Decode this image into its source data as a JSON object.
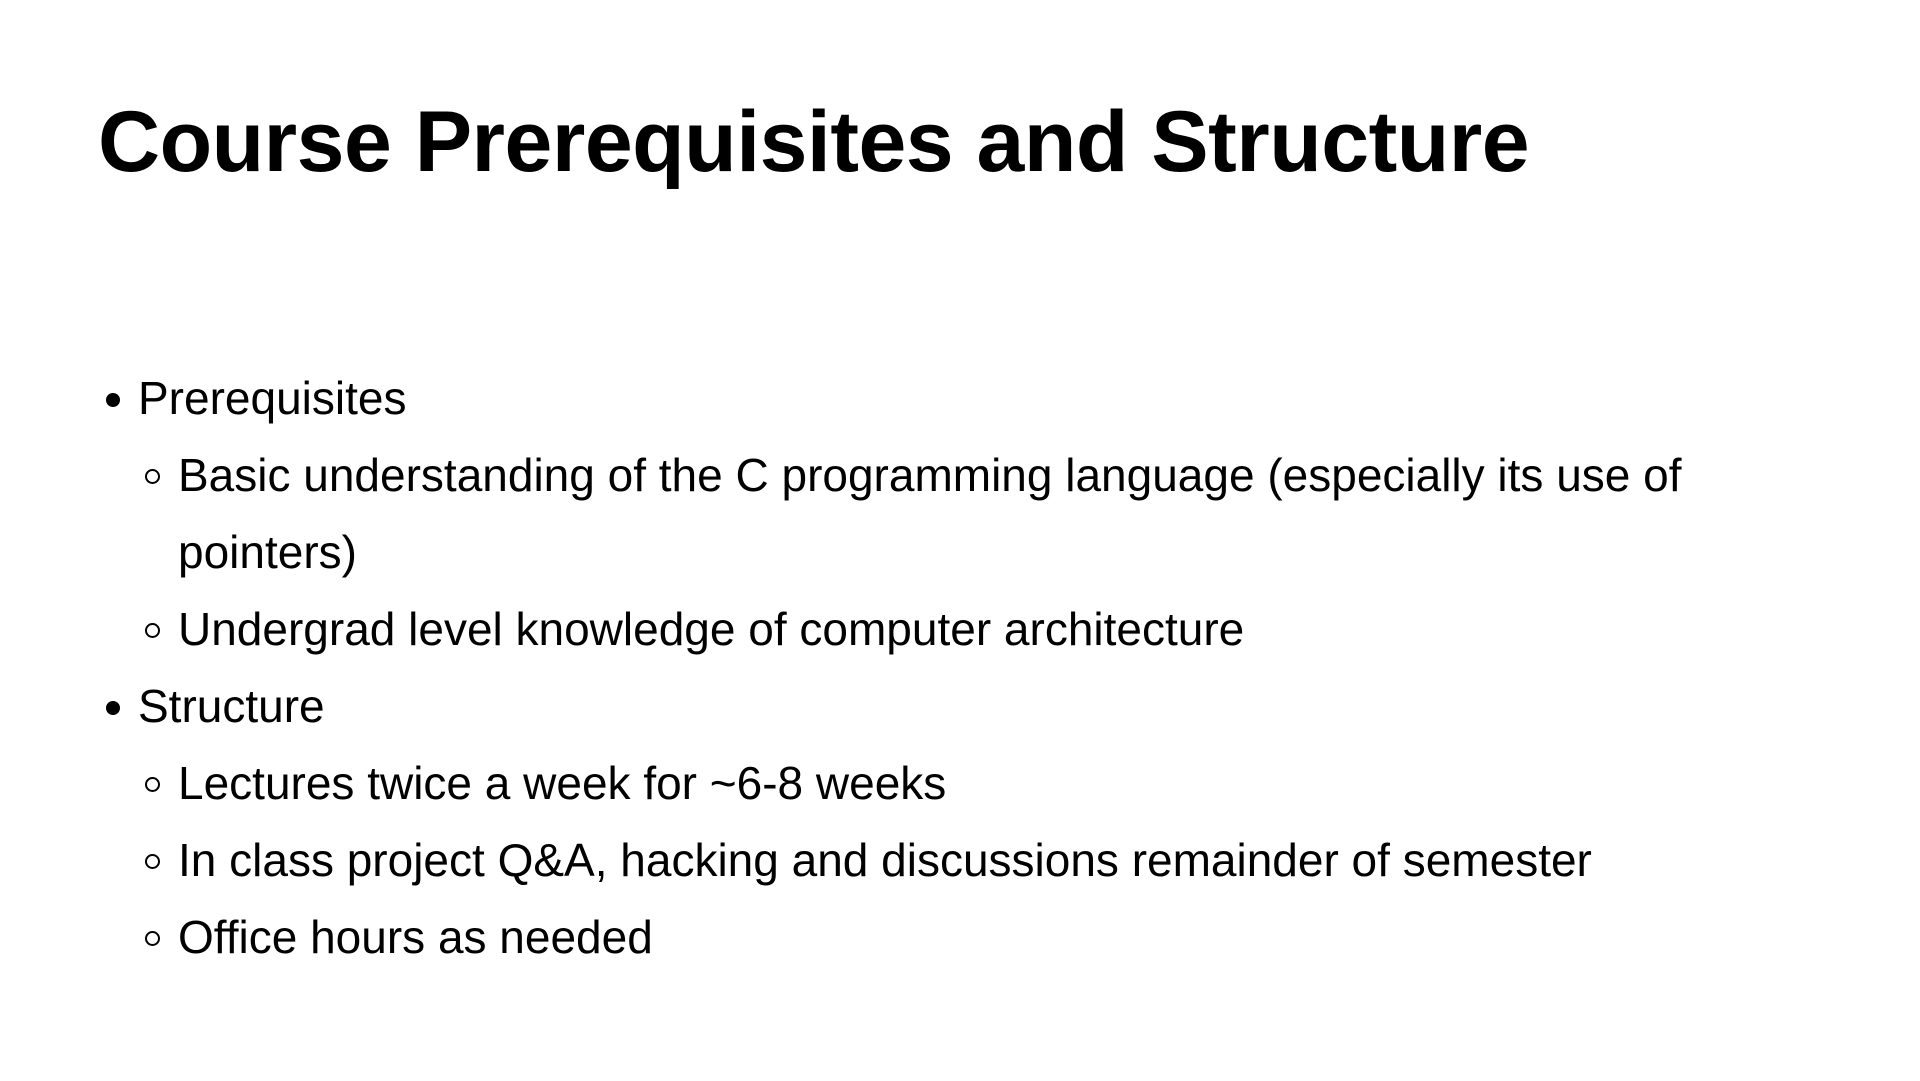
{
  "slide": {
    "title": "Course Prerequisites and Structure",
    "sections": [
      {
        "label": "Prerequisites",
        "items": [
          "Basic understanding of the C programming language (especially its use of pointers)",
          "Undergrad level knowledge of computer architecture"
        ]
      },
      {
        "label": "Structure",
        "items": [
          "Lectures twice a week for ~6-8 weeks",
          "In class project Q&A, hacking and discussions remainder of semester",
          "Office hours as needed"
        ]
      }
    ]
  },
  "icons": {
    "level1_bullet": "filled-dot-icon",
    "level2_bullet": "hollow-circle-icon"
  },
  "colors": {
    "background": "#ffffff",
    "text": "#000000"
  }
}
